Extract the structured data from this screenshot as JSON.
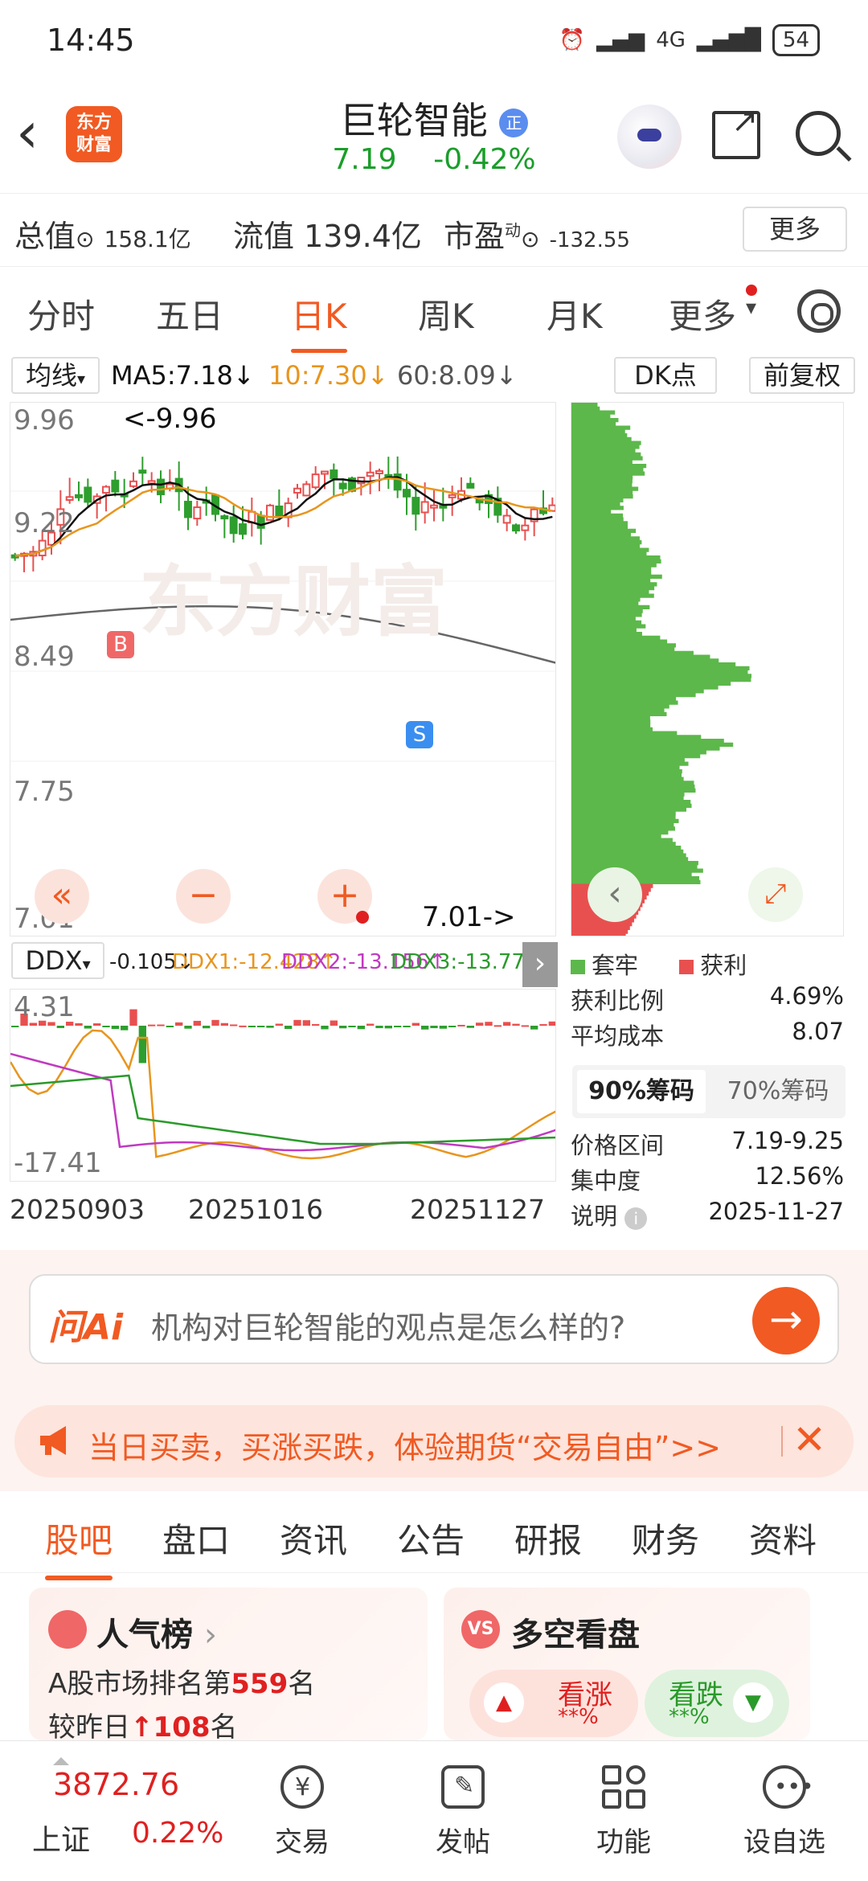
{
  "status": {
    "time": "14:45",
    "network": "4G",
    "battery": "54"
  },
  "header": {
    "logo": "东方财富",
    "title": "巨轮智能",
    "badge": "正",
    "price": "7.19",
    "change": "-0.42%"
  },
  "stats": {
    "mktcap_label": "总值",
    "mktcap_value": "158.1亿",
    "float_label": "流值",
    "float_value": "139.4亿",
    "pe_label": "市盈",
    "pe_sup": "动",
    "pe_value": "-132.55",
    "more": "更多"
  },
  "period_tabs": [
    "分时",
    "五日",
    "日K",
    "周K",
    "月K",
    "更多"
  ],
  "active_period": "日K",
  "ma": {
    "selector": "均线",
    "ma5": "MA5:7.18",
    "ma10": "10:7.30",
    "ma60": "60:8.09",
    "dk": "DK点",
    "adj": "前复权"
  },
  "kchart": {
    "y_labels": [
      "9.96",
      "9.22",
      "8.49",
      "7.75",
      "7.01"
    ],
    "high_marker": "<-9.96",
    "low_marker": "7.01->",
    "buy_marker": "B",
    "sell_marker": "S",
    "watermark": "东方财富"
  },
  "ddx": {
    "selector": "DDX",
    "ddx": "-0.105",
    "ddx1": "DDX1:-12.428",
    "ddx2": "DDX2:-13.156",
    "ddx3": "DDX3:-13.778",
    "top": "4.31",
    "bottom": "-17.41"
  },
  "dates": [
    "20250903",
    "20251016",
    "20251127"
  ],
  "chips": {
    "legend_trapped": "套牢",
    "legend_profit": "获利",
    "profit_ratio_label": "获利比例",
    "profit_ratio": "4.69%",
    "avg_cost_label": "平均成本",
    "avg_cost": "8.07",
    "seg_on": "90%筹码",
    "seg_off": "70%筹码",
    "range_label": "价格区间",
    "range": "7.19-9.25",
    "concentration_label": "集中度",
    "concentration": "12.56%",
    "note_label": "说明",
    "note_date": "2025-11-27"
  },
  "ai": {
    "logo": "问Ai",
    "question": "机构对巨轮智能的观点是怎么样的?"
  },
  "ad": {
    "text": "当日买卖，买涨买跌，体验期货“交易自由”>>"
  },
  "bottom_tabs": [
    "股吧",
    "盘口",
    "资讯",
    "公告",
    "研报",
    "财务",
    "资料"
  ],
  "cards": {
    "popularity_title": "人气榜",
    "rank_prefix": "A股市场排名第",
    "rank": "559",
    "rank_suffix": "名",
    "change_prefix": "较昨日",
    "change": "108",
    "change_suffix": "名",
    "bullbear_title": "多空看盘",
    "bull": "看涨",
    "bull_pct": "**%",
    "bear": "看跌",
    "bear_pct": "**%"
  },
  "footer": {
    "index_value": "3872.76",
    "index_name": "上证",
    "index_change": "0.22%",
    "nav": [
      "交易",
      "发帖",
      "功能",
      "设自选"
    ]
  },
  "colors": {
    "accent": "#f15a22",
    "up": "#e02020",
    "down": "#1a9e2a",
    "ma5": "#111111",
    "ma10": "#e8951d",
    "ma60": "#555555"
  }
}
